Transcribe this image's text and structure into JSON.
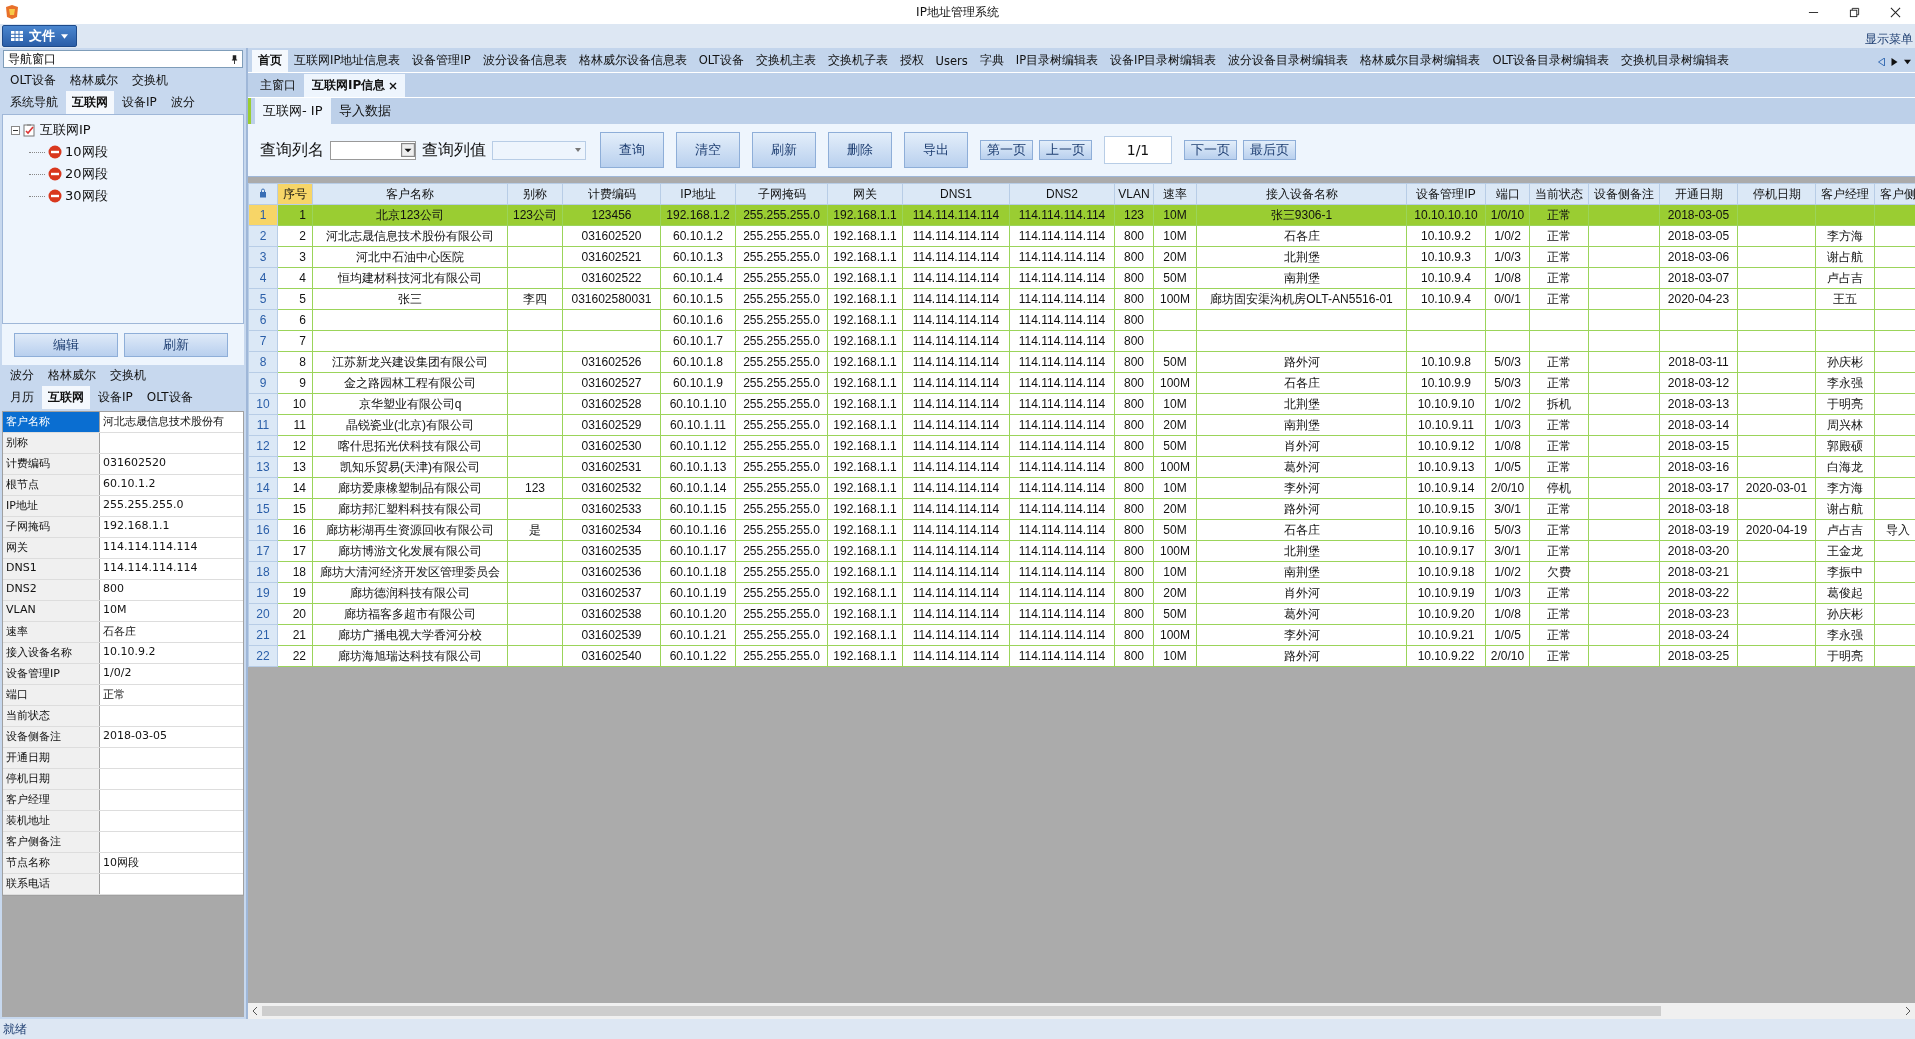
{
  "window": {
    "title": "IP地址管理系统"
  },
  "menu": {
    "file_button": "文件",
    "show_menu": "显示菜单"
  },
  "nav_panel": {
    "title": "导航窗口",
    "tab_rows": [
      [
        {
          "label": "OLT设备",
          "selected": false
        },
        {
          "label": "格林威尔",
          "selected": false
        },
        {
          "label": "交换机",
          "selected": false
        }
      ],
      [
        {
          "label": "系统导航",
          "selected": false
        },
        {
          "label": "互联网",
          "selected": true
        },
        {
          "label": "设备IP",
          "selected": false
        },
        {
          "label": "波分",
          "selected": false
        }
      ]
    ],
    "tree": [
      {
        "label": "互联网IP",
        "expanded": true,
        "children": [
          {
            "label": "10网段"
          },
          {
            "label": "20网段"
          },
          {
            "label": "30网段"
          }
        ]
      }
    ],
    "buttons": [
      "编辑",
      "刷新"
    ]
  },
  "detail_panel": {
    "tab_rows": [
      [
        {
          "label": "波分",
          "selected": false
        },
        {
          "label": "格林威尔",
          "selected": false
        },
        {
          "label": "交换机",
          "selected": false
        }
      ],
      [
        {
          "label": "月历",
          "selected": false
        },
        {
          "label": "互联网",
          "selected": true
        },
        {
          "label": "设备IP",
          "selected": false
        },
        {
          "label": "OLT设备",
          "selected": false
        }
      ]
    ],
    "properties": [
      {
        "name": "客户名称",
        "value": "河北志晟信息技术股份有",
        "selected": true
      },
      {
        "name": "别称",
        "selected": false
      },
      {
        "name": "计费编码",
        "value": "031602520",
        "selected": false
      },
      {
        "name": "根节点",
        "value": "60.10.1.2",
        "selected": false
      },
      {
        "name": "IP地址",
        "value": "255.255.255.0",
        "selected": false
      },
      {
        "name": "子网掩码",
        "value": "192.168.1.1",
        "selected": false
      },
      {
        "name": "网关",
        "value": "114.114.114.114",
        "selected": false
      },
      {
        "name": "DNS1",
        "value": "114.114.114.114",
        "selected": false
      },
      {
        "name": "DNS2",
        "value": "800",
        "selected": false
      },
      {
        "name": "VLAN",
        "value": "10M",
        "selected": false
      },
      {
        "name": "速率",
        "value": "石各庄",
        "selected": false
      },
      {
        "name": "接入设备名称",
        "value": "10.10.9.2",
        "selected": false
      },
      {
        "name": "设备管理IP",
        "value": "1/0/2",
        "selected": false
      },
      {
        "name": "端口",
        "value": "正常",
        "selected": false
      },
      {
        "name": "当前状态",
        "selected": false
      },
      {
        "name": "设备侧备注",
        "value": "2018-03-05",
        "selected": false
      },
      {
        "name": "开通日期",
        "selected": false
      },
      {
        "name": "停机日期",
        "selected": false
      },
      {
        "name": "客户经理",
        "selected": false
      },
      {
        "name": "装机地址",
        "selected": false
      },
      {
        "name": "客户侧备注",
        "selected": false
      },
      {
        "name": "节点名称",
        "value": "10网段",
        "selected": false
      },
      {
        "name": "联系电话",
        "selected": false
      }
    ]
  },
  "main_tabs": [
    {
      "label": "首页",
      "selected": true
    },
    {
      "label": "互联网IP地址信息表",
      "selected": false
    },
    {
      "label": "设备管理IP",
      "selected": false
    },
    {
      "label": "波分设备信息表",
      "selected": false
    },
    {
      "label": "格林威尔设备信息表",
      "selected": false
    },
    {
      "label": "OLT设备",
      "selected": false
    },
    {
      "label": "交换机主表",
      "selected": false
    },
    {
      "label": "交换机子表",
      "selected": false
    },
    {
      "label": "授权",
      "selected": false
    },
    {
      "label": "Users",
      "selected": false
    },
    {
      "label": "字典",
      "selected": false
    },
    {
      "label": "IP目录树编辑表",
      "selected": false
    },
    {
      "label": "设备IP目录树编辑表",
      "selected": false
    },
    {
      "label": "波分设备目录树编辑表",
      "selected": false
    },
    {
      "label": "格林威尔目录树编辑表",
      "selected": false
    },
    {
      "label": "OLT设备目录树编辑表",
      "selected": false
    },
    {
      "label": "交换机目录树编辑表",
      "selected": false
    }
  ],
  "doc_tabs": [
    {
      "label": "主窗口",
      "selected": false,
      "closable": false
    },
    {
      "label": "互联网IP信息",
      "selected": true,
      "closable": true
    }
  ],
  "inner_tabs": [
    {
      "label": "互联网- IP",
      "selected": true
    },
    {
      "label": "导入数据",
      "selected": false
    }
  ],
  "toolbar": {
    "column_label": "查询列名",
    "value_label": "查询列值",
    "action_buttons": [
      "查询",
      "清空",
      "刷新",
      "删除",
      "导出"
    ],
    "nav_buttons_before": [
      "第一页",
      "上一页"
    ],
    "page": "1/1",
    "nav_buttons_after": [
      "下一页",
      "最后页"
    ]
  },
  "table": {
    "columns": [
      "序号",
      "客户名称",
      "别称",
      "计费编码",
      "IP地址",
      "子网掩码",
      "网关",
      "DNS1",
      "DNS2",
      "VLAN",
      "速率",
      "接入设备名称",
      "设备管理IP",
      "端口",
      "当前状态",
      "设备侧备注",
      "开通日期",
      "停机日期",
      "客户经理",
      "客户侧"
    ],
    "rows": [
      {
        "row_number": "1",
        "selected": true,
        "cells": [
          "1",
          "北京123公司",
          "123公司",
          "123456",
          "192.168.1.2",
          "255.255.255.0",
          "192.168.1.1",
          "114.114.114.114",
          "114.114.114.114",
          "123",
          "10M",
          "张三9306-1",
          "10.10.10.10",
          "1/0/10",
          "正常",
          null,
          "2018-03-05",
          null,
          null,
          null
        ]
      },
      {
        "row_number": "2",
        "selected": false,
        "cells": [
          "2",
          "河北志晟信息技术股份有限公司",
          null,
          "031602520",
          "60.10.1.2",
          "255.255.255.0",
          "192.168.1.1",
          "114.114.114.114",
          "114.114.114.114",
          "800",
          "10M",
          "石各庄",
          "10.10.9.2",
          "1/0/2",
          "正常",
          null,
          "2018-03-05",
          null,
          "李方海",
          null
        ]
      },
      {
        "row_number": "3",
        "selected": false,
        "cells": [
          "3",
          "河北中石油中心医院",
          null,
          "031602521",
          "60.10.1.3",
          "255.255.255.0",
          "192.168.1.1",
          "114.114.114.114",
          "114.114.114.114",
          "800",
          "20M",
          "北荆堡",
          "10.10.9.3",
          "1/0/3",
          "正常",
          null,
          "2018-03-06",
          null,
          "谢占航",
          null
        ]
      },
      {
        "row_number": "4",
        "selected": false,
        "cells": [
          "4",
          "恒均建材科技河北有限公司",
          null,
          "031602522",
          "60.10.1.4",
          "255.255.255.0",
          "192.168.1.1",
          "114.114.114.114",
          "114.114.114.114",
          "800",
          "50M",
          "南荆堡",
          "10.10.9.4",
          "1/0/8",
          "正常",
          null,
          "2018-03-07",
          null,
          "卢占吉",
          null
        ]
      },
      {
        "row_number": "5",
        "selected": false,
        "cells": [
          "5",
          "张三",
          "李四",
          "031602580031",
          "60.10.1.5",
          "255.255.255.0",
          "192.168.1.1",
          "114.114.114.114",
          "114.114.114.114",
          "800",
          "100M",
          "廊坊固安渠沟机房OLT-AN5516-01",
          "10.10.9.4",
          "0/0/1",
          "正常",
          null,
          "2020-04-23",
          null,
          "王五",
          null
        ]
      },
      {
        "row_number": "6",
        "selected": false,
        "cells": [
          "6",
          null,
          null,
          null,
          "60.10.1.6",
          "255.255.255.0",
          "192.168.1.1",
          "114.114.114.114",
          "114.114.114.114",
          "800",
          null,
          null,
          null,
          null,
          null,
          null,
          null,
          null,
          null,
          null
        ]
      },
      {
        "row_number": "7",
        "selected": false,
        "cells": [
          "7",
          null,
          null,
          null,
          "60.10.1.7",
          "255.255.255.0",
          "192.168.1.1",
          "114.114.114.114",
          "114.114.114.114",
          "800",
          null,
          null,
          null,
          null,
          null,
          null,
          null,
          null,
          null,
          null
        ]
      },
      {
        "row_number": "8",
        "selected": false,
        "cells": [
          "8",
          "江苏新龙兴建设集团有限公司",
          null,
          "031602526",
          "60.10.1.8",
          "255.255.255.0",
          "192.168.1.1",
          "114.114.114.114",
          "114.114.114.114",
          "800",
          "50M",
          "路外河",
          "10.10.9.8",
          "5/0/3",
          "正常",
          null,
          "2018-03-11",
          null,
          "孙庆彬",
          null
        ]
      },
      {
        "row_number": "9",
        "selected": false,
        "cells": [
          "9",
          "金之路园林工程有限公司",
          null,
          "031602527",
          "60.10.1.9",
          "255.255.255.0",
          "192.168.1.1",
          "114.114.114.114",
          "114.114.114.114",
          "800",
          "100M",
          "石各庄",
          "10.10.9.9",
          "5/0/3",
          "正常",
          null,
          "2018-03-12",
          null,
          "李永强",
          null
        ]
      },
      {
        "row_number": "10",
        "selected": false,
        "cells": [
          "10",
          "京华塑业有限公司q",
          null,
          "031602528",
          "60.10.1.10",
          "255.255.255.0",
          "192.168.1.1",
          "114.114.114.114",
          "114.114.114.114",
          "800",
          "10M",
          "北荆堡",
          "10.10.9.10",
          "1/0/2",
          "拆机",
          null,
          "2018-03-13",
          null,
          "于明亮",
          null
        ]
      },
      {
        "row_number": "11",
        "selected": false,
        "cells": [
          "11",
          "晶锐瓷业(北京)有限公司",
          null,
          "031602529",
          "60.10.1.11",
          "255.255.255.0",
          "192.168.1.1",
          "114.114.114.114",
          "114.114.114.114",
          "800",
          "20M",
          "南荆堡",
          "10.10.9.11",
          "1/0/3",
          "正常",
          null,
          "2018-03-14",
          null,
          "周兴林",
          null
        ]
      },
      {
        "row_number": "12",
        "selected": false,
        "cells": [
          "12",
          "喀什思拓光伏科技有限公司",
          null,
          "031602530",
          "60.10.1.12",
          "255.255.255.0",
          "192.168.1.1",
          "114.114.114.114",
          "114.114.114.114",
          "800",
          "50M",
          "肖外河",
          "10.10.9.12",
          "1/0/8",
          "正常",
          null,
          "2018-03-15",
          null,
          "郭殿硕",
          null
        ]
      },
      {
        "row_number": "13",
        "selected": false,
        "cells": [
          "13",
          "凯知乐贸易(天津)有限公司",
          null,
          "031602531",
          "60.10.1.13",
          "255.255.255.0",
          "192.168.1.1",
          "114.114.114.114",
          "114.114.114.114",
          "800",
          "100M",
          "葛外河",
          "10.10.9.13",
          "1/0/5",
          "正常",
          null,
          "2018-03-16",
          null,
          "白海龙",
          null
        ]
      },
      {
        "row_number": "14",
        "selected": false,
        "cells": [
          "14",
          "廊坊爱康橡塑制品有限公司",
          "123",
          "031602532",
          "60.10.1.14",
          "255.255.255.0",
          "192.168.1.1",
          "114.114.114.114",
          "114.114.114.114",
          "800",
          "10M",
          "李外河",
          "10.10.9.14",
          "2/0/10",
          "停机",
          null,
          "2018-03-17",
          "2020-03-01",
          "李方海",
          null
        ]
      },
      {
        "row_number": "15",
        "selected": false,
        "cells": [
          "15",
          "廊坊邦汇塑料科技有限公司",
          null,
          "031602533",
          "60.10.1.15",
          "255.255.255.0",
          "192.168.1.1",
          "114.114.114.114",
          "114.114.114.114",
          "800",
          "20M",
          "路外河",
          "10.10.9.15",
          "3/0/1",
          "正常",
          null,
          "2018-03-18",
          null,
          "谢占航",
          null
        ]
      },
      {
        "row_number": "16",
        "selected": false,
        "cells": [
          "16",
          "廊坊彬湖再生资源回收有限公司",
          "是",
          "031602534",
          "60.10.1.16",
          "255.255.255.0",
          "192.168.1.1",
          "114.114.114.114",
          "114.114.114.114",
          "800",
          "50M",
          "石各庄",
          "10.10.9.16",
          "5/0/3",
          "正常",
          null,
          "2018-03-19",
          "2020-04-19",
          "卢占吉",
          "导入"
        ]
      },
      {
        "row_number": "17",
        "selected": false,
        "cells": [
          "17",
          "廊坊博游文化发展有限公司",
          null,
          "031602535",
          "60.10.1.17",
          "255.255.255.0",
          "192.168.1.1",
          "114.114.114.114",
          "114.114.114.114",
          "800",
          "100M",
          "北荆堡",
          "10.10.9.17",
          "3/0/1",
          "正常",
          null,
          "2018-03-20",
          null,
          "王金龙",
          null
        ]
      },
      {
        "row_number": "18",
        "selected": false,
        "cells": [
          "18",
          "廊坊大清河经济开发区管理委员会",
          null,
          "031602536",
          "60.10.1.18",
          "255.255.255.0",
          "192.168.1.1",
          "114.114.114.114",
          "114.114.114.114",
          "800",
          "10M",
          "南荆堡",
          "10.10.9.18",
          "1/0/2",
          "欠费",
          null,
          "2018-03-21",
          null,
          "李振中",
          null
        ]
      },
      {
        "row_number": "19",
        "selected": false,
        "cells": [
          "19",
          "廊坊德润科技有限公司",
          null,
          "031602537",
          "60.10.1.19",
          "255.255.255.0",
          "192.168.1.1",
          "114.114.114.114",
          "114.114.114.114",
          "800",
          "20M",
          "肖外河",
          "10.10.9.19",
          "1/0/3",
          "正常",
          null,
          "2018-03-22",
          null,
          "葛俊起",
          null
        ]
      },
      {
        "row_number": "20",
        "selected": false,
        "cells": [
          "20",
          "廊坊福客多超市有限公司",
          null,
          "031602538",
          "60.10.1.20",
          "255.255.255.0",
          "192.168.1.1",
          "114.114.114.114",
          "114.114.114.114",
          "800",
          "50M",
          "葛外河",
          "10.10.9.20",
          "1/0/8",
          "正常",
          null,
          "2018-03-23",
          null,
          "孙庆彬",
          null
        ]
      },
      {
        "row_number": "21",
        "selected": false,
        "cells": [
          "21",
          "廊坊广播电视大学香河分校",
          null,
          "031602539",
          "60.10.1.21",
          "255.255.255.0",
          "192.168.1.1",
          "114.114.114.114",
          "114.114.114.114",
          "800",
          "100M",
          "李外河",
          "10.10.9.21",
          "1/0/5",
          "正常",
          null,
          "2018-03-24",
          null,
          "李永强",
          null
        ]
      },
      {
        "row_number": "22",
        "selected": false,
        "cells": [
          "22",
          "廊坊海旭瑞达科技有限公司",
          null,
          "031602540",
          "60.10.1.22",
          "255.255.255.0",
          "192.168.1.1",
          "114.114.114.114",
          "114.114.114.114",
          "800",
          "10M",
          "路外河",
          "10.10.9.22",
          "2/0/10",
          "正常",
          null,
          "2018-03-25",
          null,
          "于明亮",
          null
        ]
      }
    ]
  },
  "status_bar": "就绪"
}
